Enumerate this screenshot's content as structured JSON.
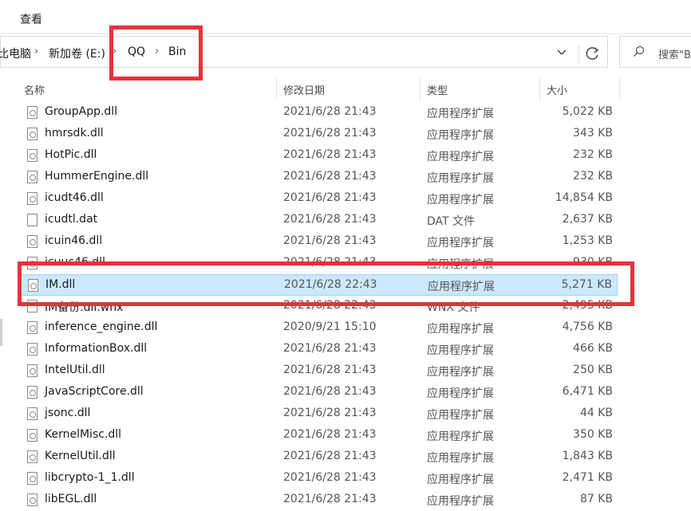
{
  "ribbon": {
    "tab_view": "查看"
  },
  "address_bar": {
    "crumbs": [
      "比电脑",
      "新加卷 (E:)",
      "QQ",
      "Bin"
    ]
  },
  "search": {
    "placeholder": "搜索\"B"
  },
  "columns": {
    "name": "名称",
    "date": "修改日期",
    "type": "类型",
    "size": "大小"
  },
  "files": [
    {
      "name": "GroupApp.dll",
      "date": "2021/6/28 21:43",
      "type": "应用程序扩展",
      "size": "5,022 KB",
      "icon": "dll-file-icon"
    },
    {
      "name": "hmrsdk.dll",
      "date": "2021/6/28 21:43",
      "type": "应用程序扩展",
      "size": "343 KB",
      "icon": "dll-file-icon"
    },
    {
      "name": "HotPic.dll",
      "date": "2021/6/28 21:43",
      "type": "应用程序扩展",
      "size": "232 KB",
      "icon": "dll-file-icon"
    },
    {
      "name": "HummerEngine.dll",
      "date": "2021/6/28 21:43",
      "type": "应用程序扩展",
      "size": "232 KB",
      "icon": "dll-file-icon"
    },
    {
      "name": "icudt46.dll",
      "date": "2021/6/28 21:43",
      "type": "应用程序扩展",
      "size": "14,854 KB",
      "icon": "dll-file-icon"
    },
    {
      "name": "icudtl.dat",
      "date": "2021/6/28 21:43",
      "type": "DAT 文件",
      "size": "2,637 KB",
      "icon": "blank-file-icon"
    },
    {
      "name": "icuin46.dll",
      "date": "2021/6/28 21:43",
      "type": "应用程序扩展",
      "size": "1,253 KB",
      "icon": "dll-file-icon"
    },
    {
      "name": "icuuc46.dll",
      "date": "2021/6/28 21:43",
      "type": "应用程序扩展",
      "size": "930 KB",
      "icon": "dll-file-icon"
    },
    {
      "name": "IM.dll",
      "date": "2021/6/28 22:43",
      "type": "应用程序扩展",
      "size": "5,271 KB",
      "icon": "dll-file-icon",
      "selected": true
    },
    {
      "name": "IM备份.dll.wnx",
      "date": "2021/6/28 22:43",
      "type": "WNX 文件",
      "size": "2,495 KB",
      "icon": "blank-file-icon"
    },
    {
      "name": "inference_engine.dll",
      "date": "2020/9/21 15:10",
      "type": "应用程序扩展",
      "size": "4,756 KB",
      "icon": "dll-file-icon"
    },
    {
      "name": "InformationBox.dll",
      "date": "2021/6/28 21:43",
      "type": "应用程序扩展",
      "size": "466 KB",
      "icon": "dll-file-icon"
    },
    {
      "name": "IntelUtil.dll",
      "date": "2021/6/28 21:43",
      "type": "应用程序扩展",
      "size": "250 KB",
      "icon": "dll-file-icon"
    },
    {
      "name": "JavaScriptCore.dll",
      "date": "2021/6/28 21:43",
      "type": "应用程序扩展",
      "size": "6,471 KB",
      "icon": "dll-file-icon"
    },
    {
      "name": "jsonc.dll",
      "date": "2021/6/28 21:43",
      "type": "应用程序扩展",
      "size": "44 KB",
      "icon": "dll-file-icon"
    },
    {
      "name": "KernelMisc.dll",
      "date": "2021/6/28 21:43",
      "type": "应用程序扩展",
      "size": "350 KB",
      "icon": "dll-file-icon"
    },
    {
      "name": "KernelUtil.dll",
      "date": "2021/6/28 21:43",
      "type": "应用程序扩展",
      "size": "1,843 KB",
      "icon": "dll-file-icon"
    },
    {
      "name": "libcrypto-1_1.dll",
      "date": "2021/6/28 21:43",
      "type": "应用程序扩展",
      "size": "2,471 KB",
      "icon": "dll-file-icon"
    },
    {
      "name": "libEGL.dll",
      "date": "2021/6/28 21:43",
      "type": "应用程序扩展",
      "size": "87 KB",
      "icon": "dll-file-icon"
    }
  ],
  "colors": {
    "highlight": "#e8313a",
    "selection": "#cce8ff",
    "selection_border": "#99d1ff"
  }
}
